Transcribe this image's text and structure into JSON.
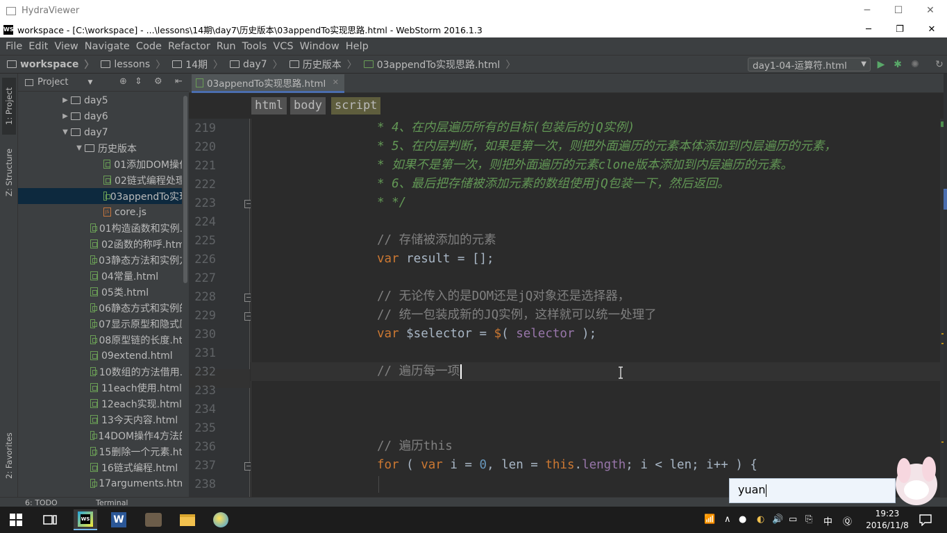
{
  "hydra": {
    "title": "HydraViewer"
  },
  "window": {
    "title": "workspace - [C:\\workspace] - ...\\lessons\\14期\\day7\\历史版本\\03appendTo实现思路.html - WebStorm 2016.1.3"
  },
  "menu": [
    "File",
    "Edit",
    "View",
    "Navigate",
    "Code",
    "Refactor",
    "Run",
    "Tools",
    "VCS",
    "Window",
    "Help"
  ],
  "nav": {
    "crumbs": [
      "workspace",
      "lessons",
      "14期",
      "day7",
      "历史版本",
      "03appendTo实现思路.html"
    ],
    "run_config": "day1-04-运算符.html"
  },
  "left_tabs": {
    "project": "1: Project",
    "structure": "Z: Structure",
    "favorites": "2: Favorites"
  },
  "project": {
    "header": "Project",
    "items": [
      {
        "label": "day5",
        "type": "folder",
        "state": "collapsed"
      },
      {
        "label": "day6",
        "type": "folder",
        "state": "collapsed"
      },
      {
        "label": "day7",
        "type": "folder",
        "state": "expanded"
      },
      {
        "label": "历史版本",
        "type": "folder",
        "state": "expanded"
      },
      {
        "label": "01添加DOM操作",
        "type": "html"
      },
      {
        "label": "02链式编程处理.",
        "type": "html"
      },
      {
        "label": "03appendTo实现",
        "type": "html",
        "selected": true
      },
      {
        "label": "core.js",
        "type": "js"
      },
      {
        "label": "01构造函数和实例.h",
        "type": "html"
      },
      {
        "label": "02函数的称呼.html",
        "type": "html"
      },
      {
        "label": "03静态方法和实例方",
        "type": "html"
      },
      {
        "label": "04常量.html",
        "type": "html"
      },
      {
        "label": "05类.html",
        "type": "html"
      },
      {
        "label": "06静态方式和实例的",
        "type": "html"
      },
      {
        "label": "07显示原型和隐式原",
        "type": "html"
      },
      {
        "label": "08原型链的长度.htn",
        "type": "html"
      },
      {
        "label": "09extend.html",
        "type": "html"
      },
      {
        "label": "10数组的方法借用.h",
        "type": "html"
      },
      {
        "label": "11each使用.html",
        "type": "html"
      },
      {
        "label": "12each实现.html",
        "type": "html"
      },
      {
        "label": "13今天内容.html",
        "type": "html"
      },
      {
        "label": "14DOM操作4方法的",
        "type": "html"
      },
      {
        "label": "15删除一个元素.htn",
        "type": "html"
      },
      {
        "label": "16链式编程.html",
        "type": "html"
      },
      {
        "label": "17arguments.html",
        "type": "html"
      }
    ]
  },
  "editor": {
    "tab": "03appendTo实现思路.html",
    "tag_crumbs": [
      "html",
      "body",
      "script"
    ],
    "line_numbers": [
      "219",
      "220",
      "221",
      "222",
      "223",
      "224",
      "225",
      "226",
      "227",
      "228",
      "229",
      "230",
      "231",
      "232",
      "233",
      "234",
      "235",
      "236",
      "237",
      "238"
    ],
    "lines": {
      "l219": "* 4、在内层遍历所有的目标(包装后的jQ实例)",
      "l220": "* 5、在内层判断，如果是第一次，则把外面遍历的元素本体添加到内层遍历的元素，",
      "l221": "* 如果不是第一次，则把外面遍历的元素clone版本添加到内层遍历的元素。",
      "l222": "* 6、最后把存储被添加元素的数组使用jQ包装一下，然后返回。",
      "l223": "* */",
      "l225": "// 存储被添加的元素",
      "l226_kw": "var",
      "l226_rest": " result = [];",
      "l228": "// 无论传入的是DOM还是jQ对象还是选择器，",
      "l229": "// 统一包装成新的JQ实例，这样就可以统一处理了",
      "l230_kw": "var",
      "l230_var": " $selector = ",
      "l230_fn": "$",
      "l230_open": "( ",
      "l230_arg": "selector",
      "l230_close": " );",
      "l232": "// 遍历每一项",
      "l236": "// 遍历this",
      "l237_for": "for",
      "l237_a": " ( ",
      "l237_var": "var",
      "l237_b": " i = ",
      "l237_zero": "0",
      "l237_c": ", len = ",
      "l237_this": "this",
      "l237_d": ".",
      "l237_len": "length",
      "l237_e": "; i < len; i++ ) {"
    }
  },
  "bottom": {
    "todo": "6: TODO",
    "terminal": "Terminal"
  },
  "ime": {
    "text": "yuan"
  },
  "taskbar": {
    "clock_time": "19:23",
    "clock_date": "2016/11/8",
    "lang": "中"
  }
}
